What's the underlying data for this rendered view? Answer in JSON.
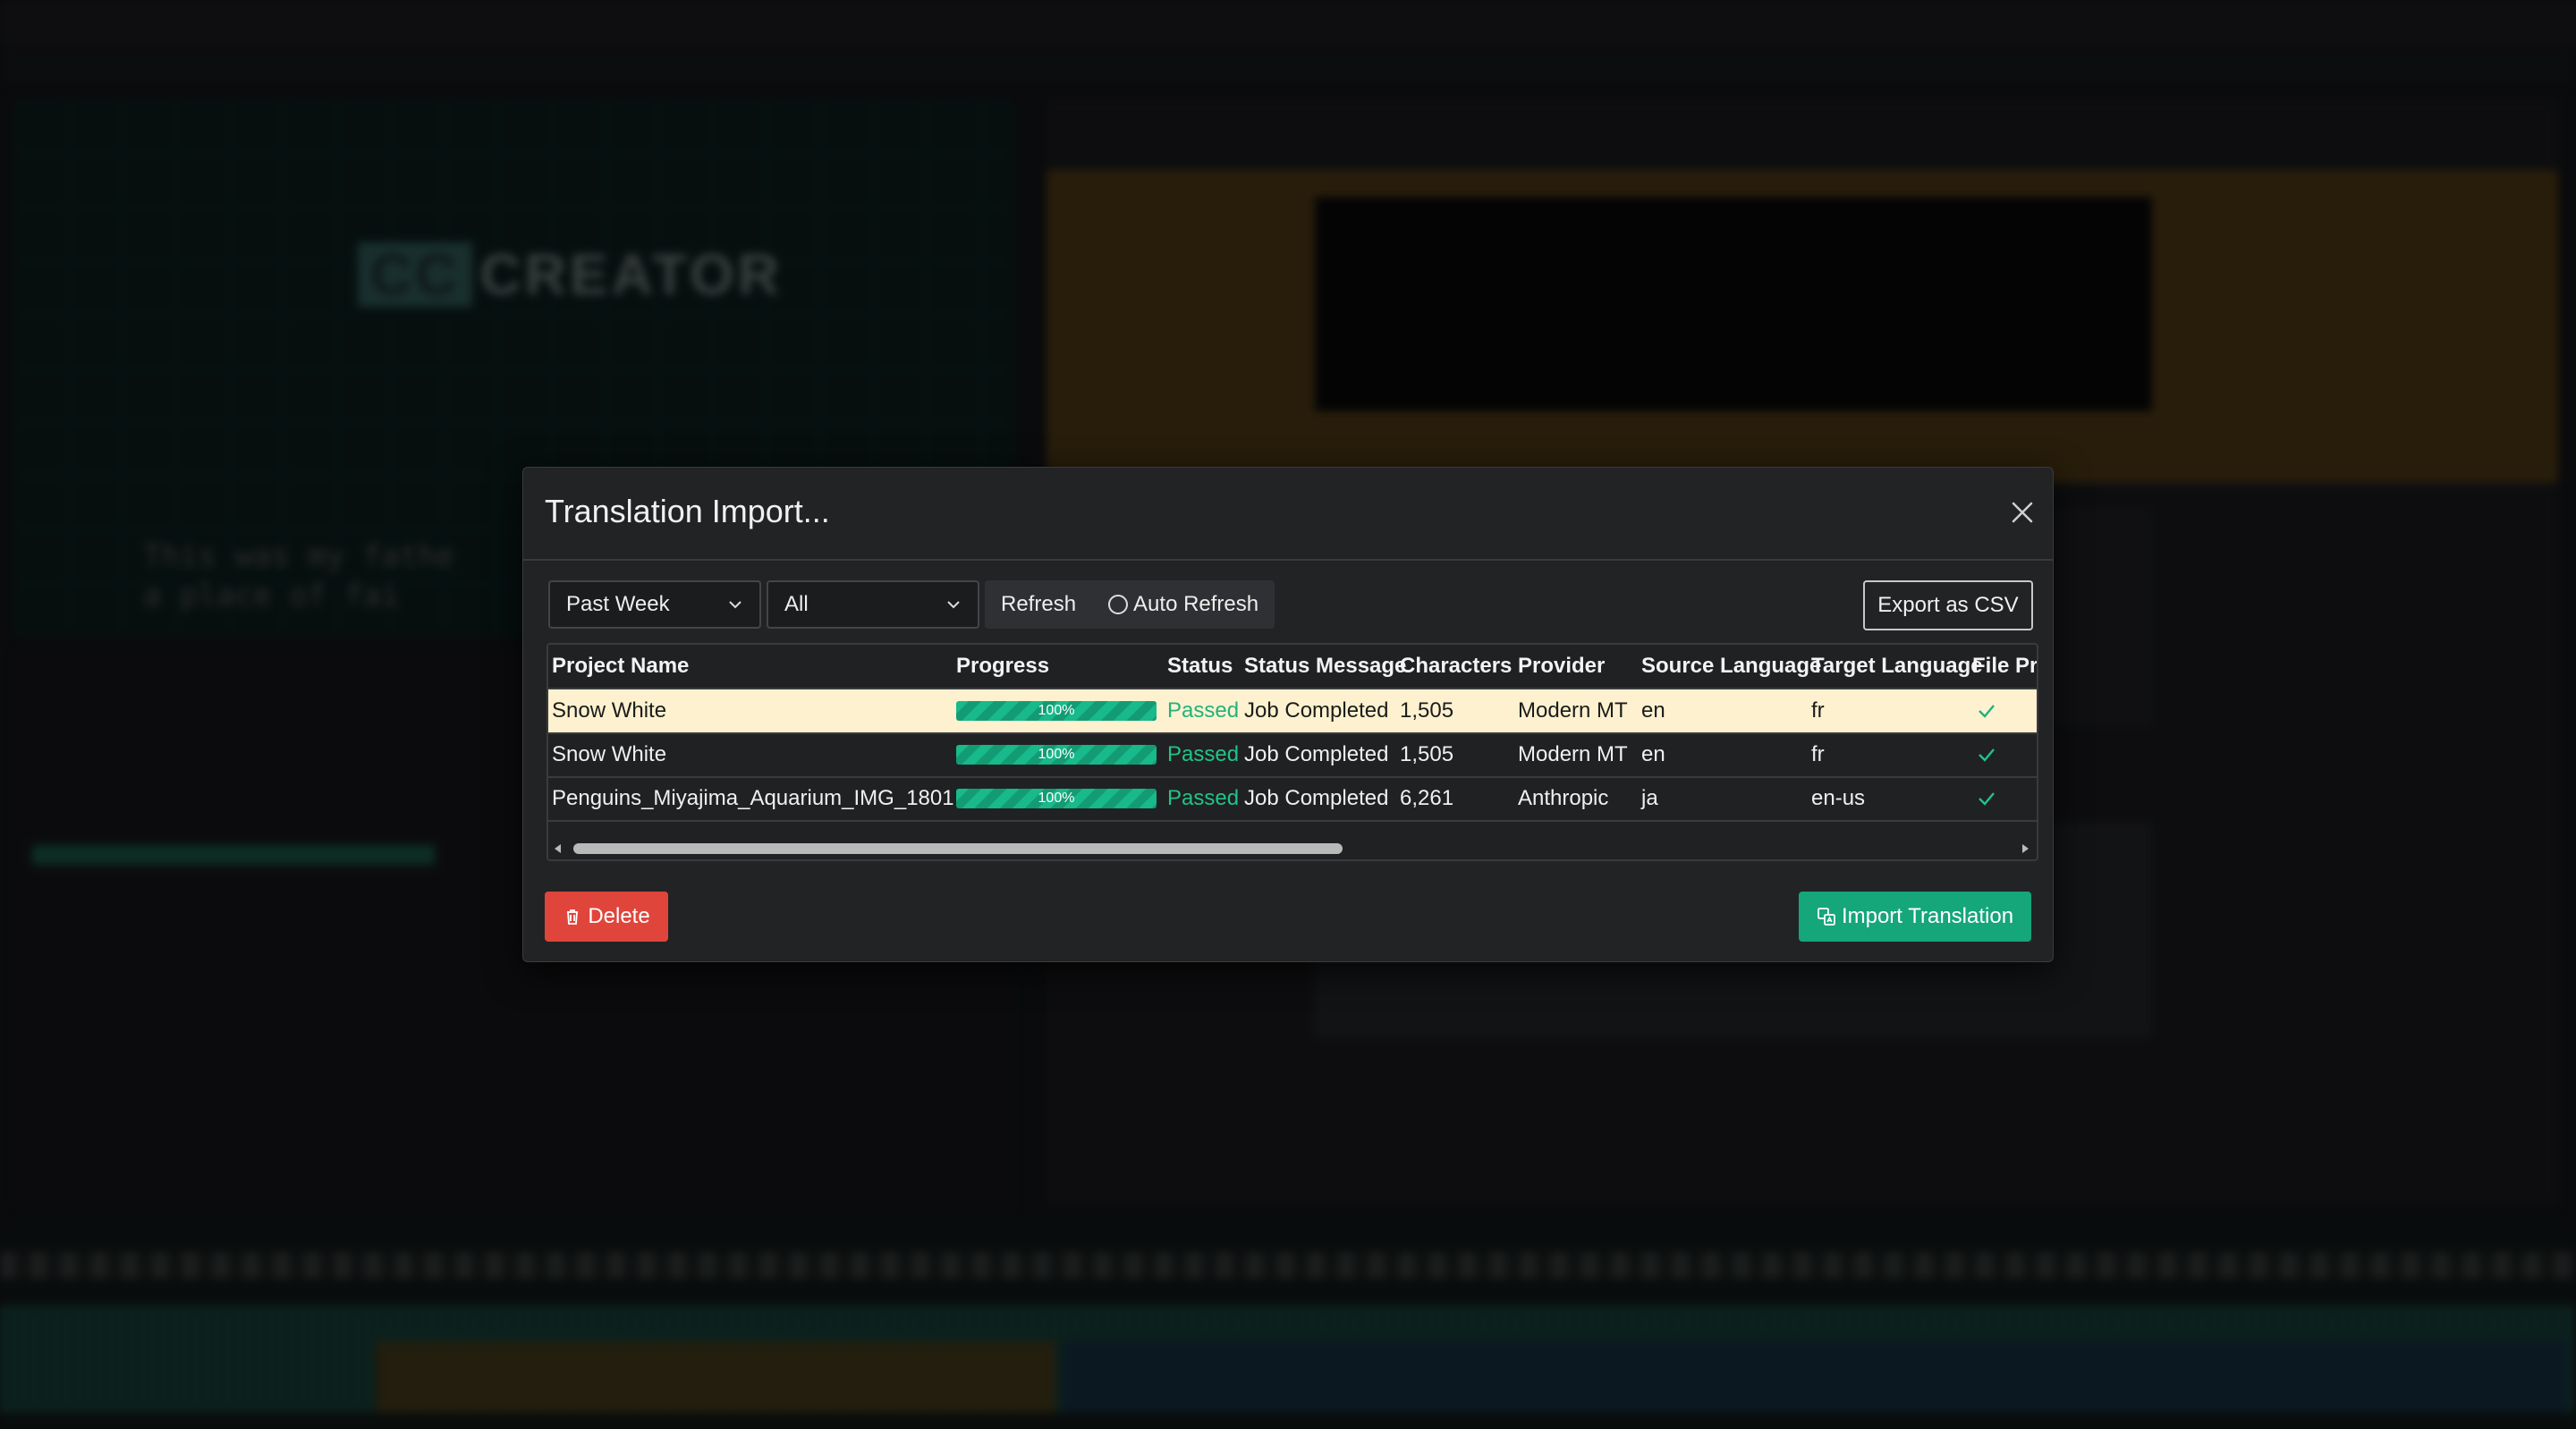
{
  "dialog": {
    "title": "Translation Import...",
    "close_icon": "close-icon"
  },
  "filters": {
    "range_value": "Past Week",
    "status_value": "All",
    "refresh_label": "Refresh",
    "auto_refresh_label": "Auto Refresh",
    "export_label": "Export as CSV"
  },
  "table": {
    "columns": [
      "Project Name",
      "Progress",
      "Status",
      "Status Message",
      "Characters",
      "Provider",
      "Source Language",
      "Target Language",
      "File Pr"
    ],
    "rows": [
      {
        "project": "Snow White",
        "progress_label": "100%",
        "progress": 1.0,
        "status": "Passed",
        "message": "Job Completed",
        "characters": "1,505",
        "provider": "Modern MT",
        "source": "en",
        "target": "fr",
        "file_icon": "check-icon",
        "selected": true
      },
      {
        "project": "Snow White",
        "progress_label": "100%",
        "progress": 1.0,
        "status": "Passed",
        "message": "Job Completed",
        "characters": "1,505",
        "provider": "Modern MT",
        "source": "en",
        "target": "fr",
        "file_icon": "check-icon",
        "selected": false
      },
      {
        "project": "Penguins_Miyajima_Aquarium_IMG_1801",
        "progress_label": "100%",
        "progress": 1.0,
        "status": "Passed",
        "message": "Job Completed",
        "characters": "6,261",
        "provider": "Anthropic",
        "source": "ja",
        "target": "en-us",
        "file_icon": "check-icon",
        "selected": false
      }
    ]
  },
  "actions": {
    "delete_label": "Delete",
    "import_label": "Import Translation"
  },
  "colors": {
    "accent": "#15a67a",
    "danger": "#e0453c",
    "passed": "#22c387",
    "selected_row": "#fdf1cf"
  },
  "background": {
    "logo_text": "CREATOR",
    "logo_badge": "CC",
    "subtitle_line1": "This was my fathe",
    "subtitle_line2": "a place of fai"
  }
}
